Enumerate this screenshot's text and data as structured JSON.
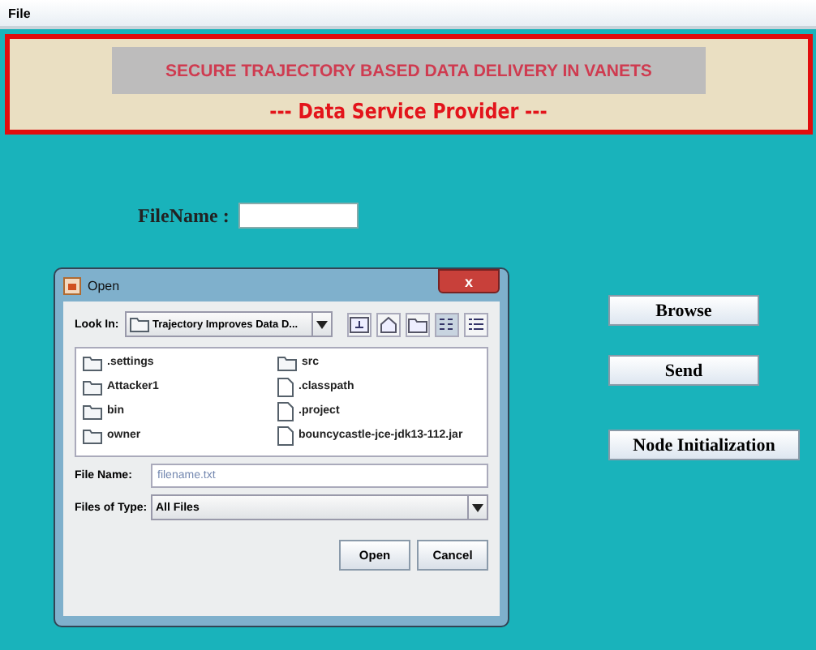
{
  "menu": [
    "File"
  ],
  "header": {
    "title": "SECURE TRAJECTORY BASED DATA DELIVERY IN VANETS",
    "subtitle": "--- Data Service Provider ---"
  },
  "filename_field": {
    "label": "FileName :"
  },
  "buttons": [
    "Browse",
    "Send",
    "Node Initialization"
  ],
  "dialog": {
    "title": "Open",
    "close": "x",
    "look_in_label": "Look In:",
    "look_in_value": "Trajectory Improves Data D...",
    "files": [
      {
        "name": ".settings",
        "kind": "folder"
      },
      {
        "name": "Attacker1",
        "kind": "folder"
      },
      {
        "name": "bin",
        "kind": "folder"
      },
      {
        "name": "owner",
        "kind": "folder"
      },
      {
        "name": "src",
        "kind": "folder"
      },
      {
        "name": ".classpath",
        "kind": "file"
      },
      {
        "name": ".project",
        "kind": "file"
      },
      {
        "name": "bouncycastle-jce-jdk13-112.jar",
        "kind": "file"
      }
    ],
    "file_name_label": "File Name:",
    "file_name_value": "filename.txt",
    "type_label": "Files of Type:",
    "type_value": "All Files",
    "buttons": [
      "Open",
      "Cancel"
    ]
  }
}
